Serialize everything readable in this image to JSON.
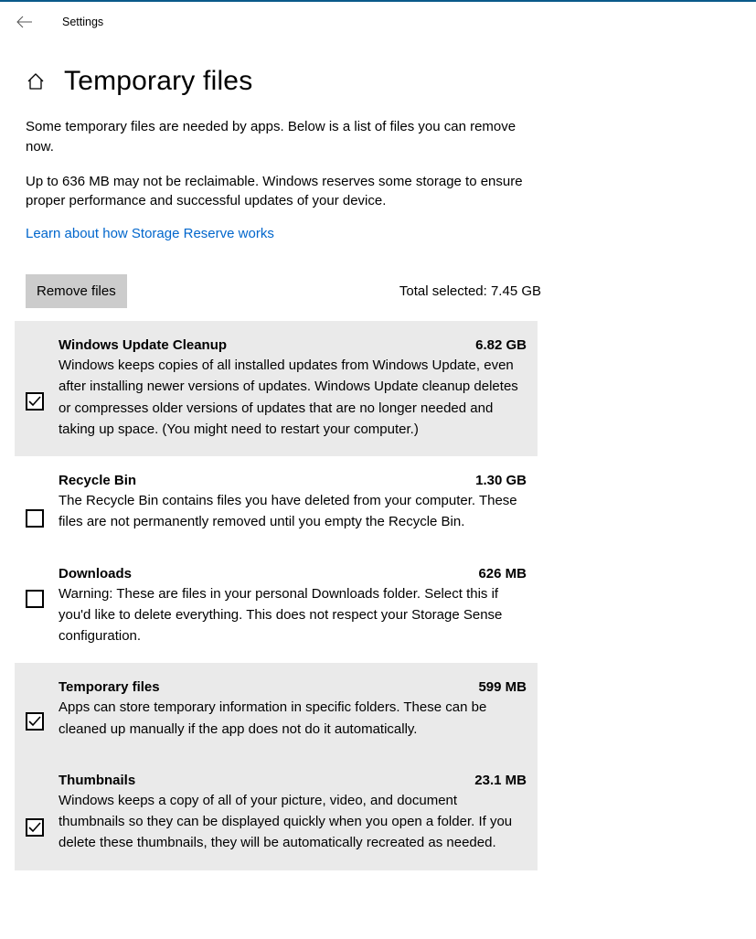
{
  "header": {
    "title": "Settings"
  },
  "page": {
    "title": "Temporary files",
    "intro1": "Some temporary files are needed by apps. Below is a list of files you can remove now.",
    "intro2": "Up to 636 MB may not be reclaimable. Windows reserves some storage to ensure proper performance and successful updates of your device.",
    "link": "Learn about how Storage Reserve works",
    "remove_button": "Remove files",
    "total_selected": "Total selected: 7.45 GB"
  },
  "items": [
    {
      "title": "Windows Update Cleanup",
      "size": "6.82 GB",
      "desc": "Windows keeps copies of all installed updates from Windows Update, even after installing newer versions of updates. Windows Update cleanup deletes or compresses older versions of updates that are no longer needed and taking up space. (You might need to restart your computer.)"
    },
    {
      "title": "Recycle Bin",
      "size": "1.30 GB",
      "desc": "The Recycle Bin contains files you have deleted from your computer. These files are not permanently removed until you empty the Recycle Bin."
    },
    {
      "title": "Downloads",
      "size": "626 MB",
      "desc": "Warning: These are files in your personal Downloads folder. Select this if you'd like to delete everything. This does not respect your Storage Sense configuration."
    },
    {
      "title": "Temporary files",
      "size": "599 MB",
      "desc": "Apps can store temporary information in specific folders. These can be cleaned up manually if the app does not do it automatically."
    },
    {
      "title": "Thumbnails",
      "size": "23.1 MB",
      "desc": "Windows keeps a copy of all of your picture, video, and document thumbnails so they can be displayed quickly when you open a folder. If you delete these thumbnails, they will be automatically recreated as needed."
    }
  ]
}
